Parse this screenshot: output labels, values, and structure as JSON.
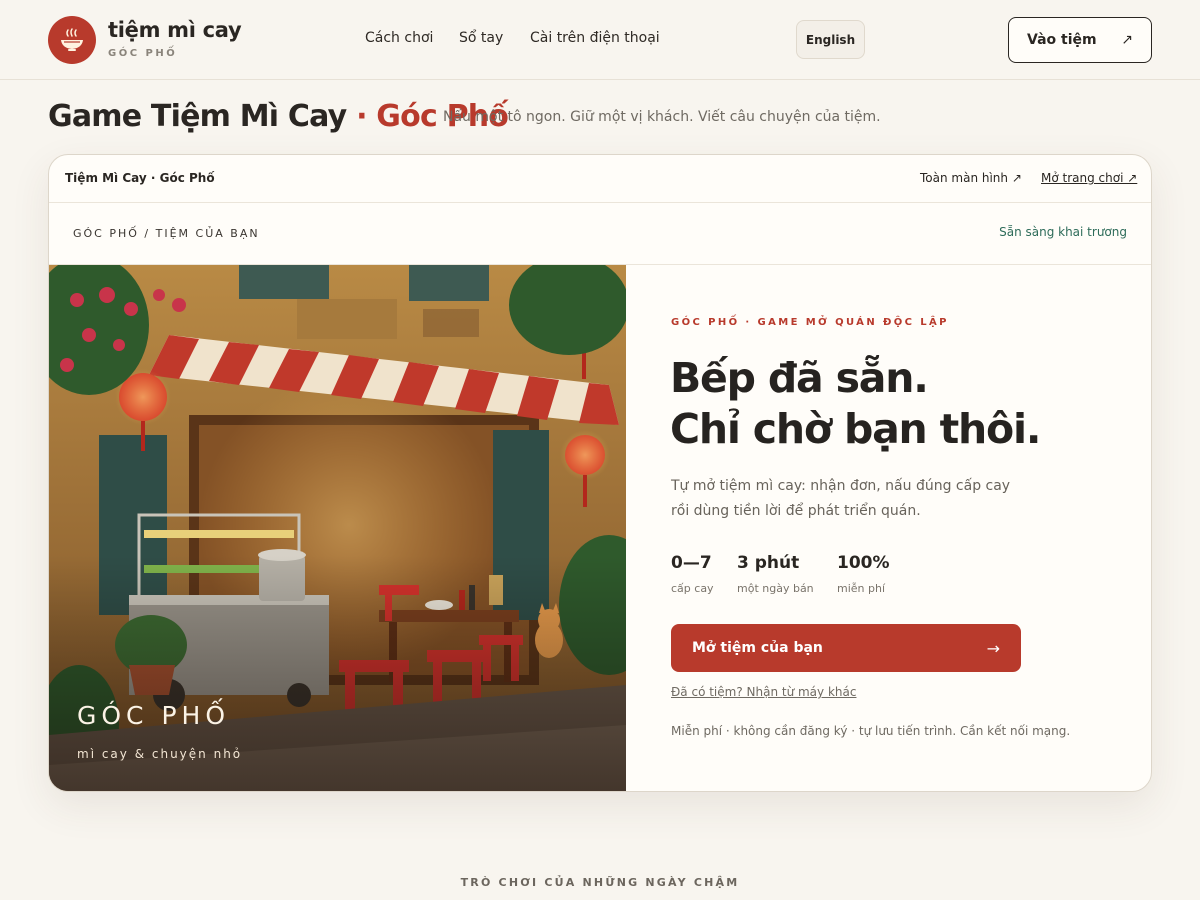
{
  "header": {
    "logo_icon": "noodle-bowl-icon",
    "brand_name": "tiệm mì cay",
    "brand_sub": "GÓC PHỐ",
    "nav": [
      "Cách chơi",
      "Sổ tay",
      "Cài trên điện thoại"
    ],
    "lang_label": "English",
    "enter_label": "Vào tiệm",
    "enter_icon": "arrow-up-right-icon"
  },
  "page": {
    "title_main": "Game Tiệm Mì Cay",
    "title_accent": "· Góc Phố",
    "tagline": "Nấu một tô ngon. Giữ một vị khách. Viết câu chuyện của tiệm."
  },
  "card": {
    "bar_title": "Tiệm Mì Cay · Góc Phố",
    "fullscreen": "Toàn màn hình ↗",
    "open_page": "Mở trang chơi ↗",
    "breadcrumb": "GÓC PHỐ / TIỆM CỦA BẠN",
    "status": "Sẵn sàng khai trương",
    "scene": {
      "title": "GÓC PHỐ",
      "subtitle": "mì cay & chuyện nhỏ"
    },
    "kicker": "GÓC PHỐ · GAME MỞ QUÁN ĐỘC LẬP",
    "headline_1": "Bếp đã sẵn.",
    "headline_2": "Chỉ chờ bạn thôi.",
    "description": "Tự mở tiệm mì cay: nhận đơn, nấu đúng cấp cay rồi dùng tiền lời để phát triển quán.",
    "stats": [
      {
        "value": "0—7",
        "label": "cấp cay"
      },
      {
        "value": "3 phút",
        "label": "một ngày bán"
      },
      {
        "value": "100%",
        "label": "miễn phí"
      }
    ],
    "cta_label": "Mở tiệm của bạn",
    "cta_icon": "arrow-right-icon",
    "secondary_link": "Đã có tiệm? Nhận từ máy khác",
    "footnote": "Miễn phí · không cần đăng ký · tự lưu tiến trình. Cần kết nối mạng."
  },
  "bottom_kicker": "TRÒ CHƠI CỦA NHỮNG NGÀY CHẬM",
  "colors": {
    "accent": "#b83a2c",
    "status": "#2e6c5a",
    "background": "#f8f5ef"
  }
}
